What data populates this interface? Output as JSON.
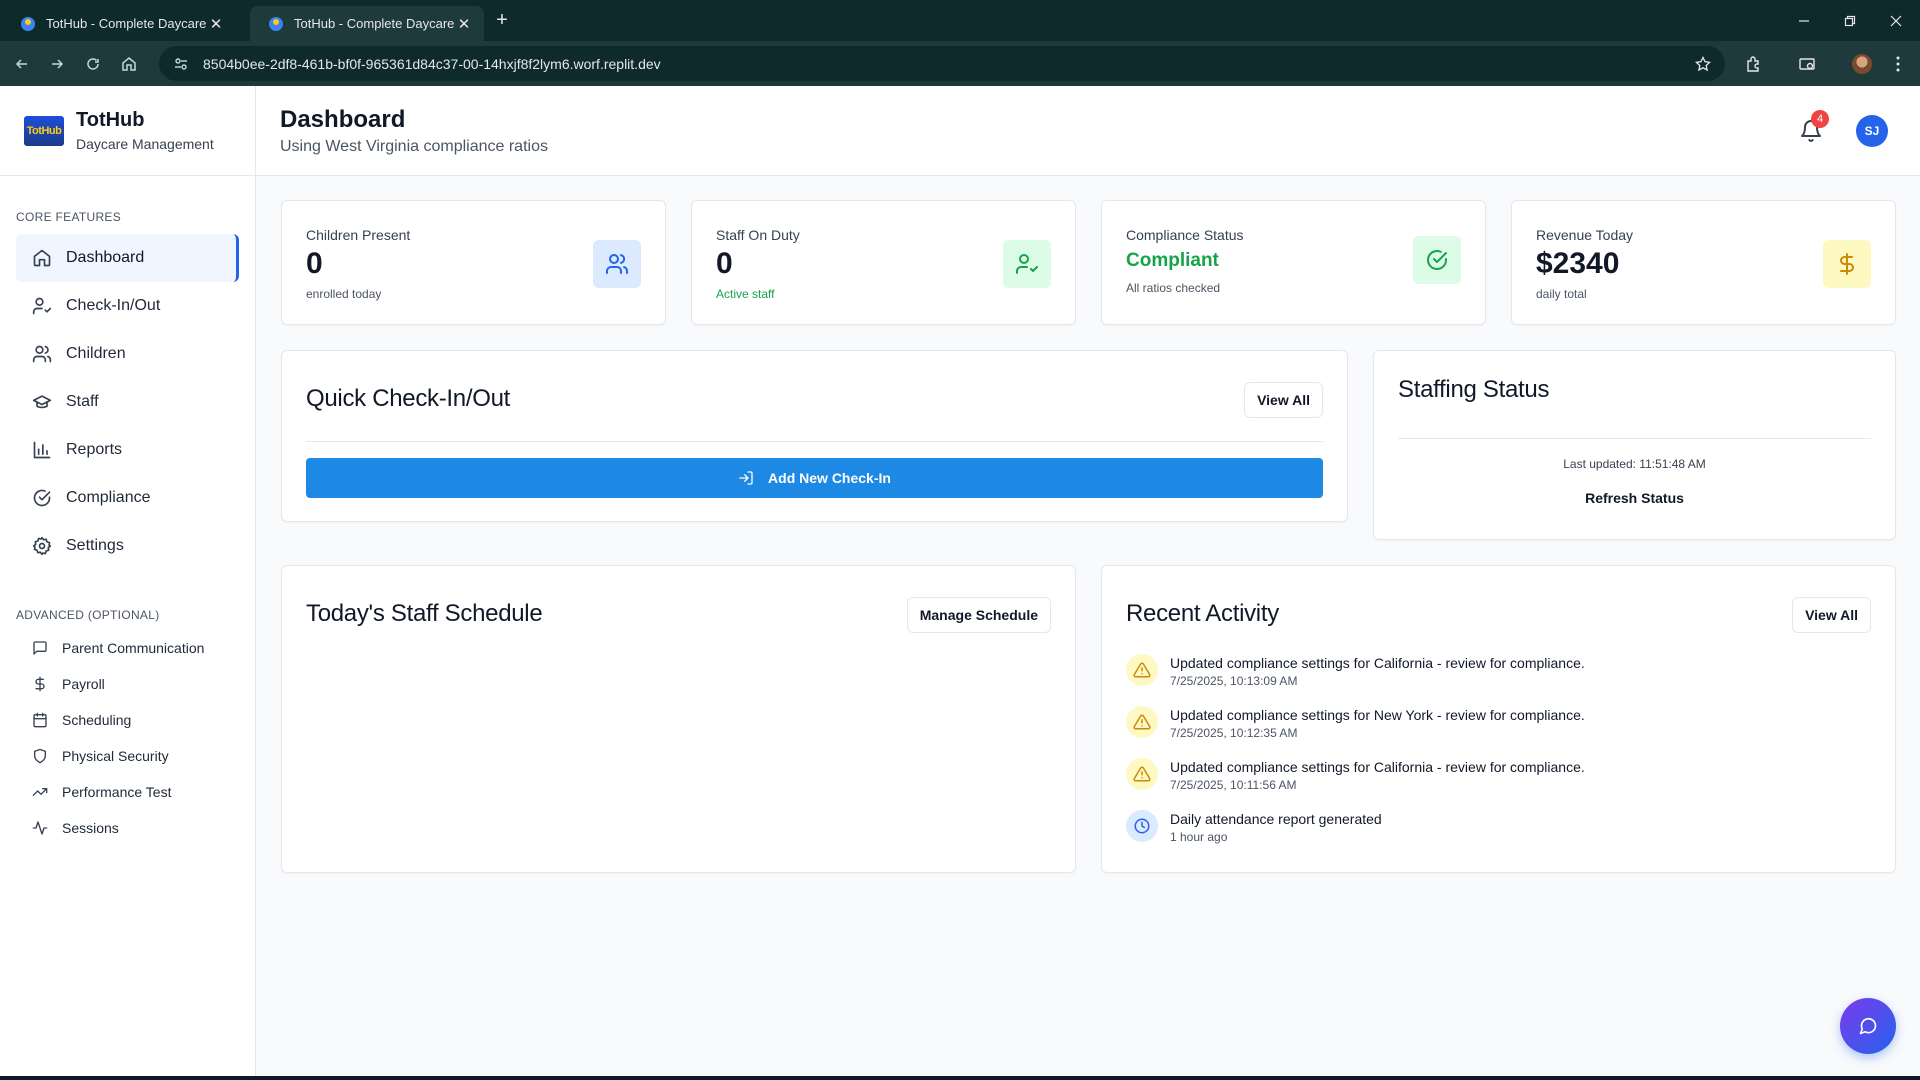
{
  "browser": {
    "tabs": [
      {
        "title": "TotHub - Complete Daycare Ma"
      },
      {
        "title": "TotHub - Complete Daycare Ma"
      }
    ],
    "url": "8504b0ee-2df8-461b-bf0f-965361d84c37-00-14hxjf8f2lym6.worf.replit.dev"
  },
  "sidebar": {
    "brand_logo_text": "TotHub",
    "brand_name": "TotHub",
    "brand_sub": "Daycare Management",
    "core_label": "CORE FEATURES",
    "core_items": [
      {
        "label": "Dashboard",
        "icon": "home-icon",
        "active": true
      },
      {
        "label": "Check-In/Out",
        "icon": "user-check-icon"
      },
      {
        "label": "Children",
        "icon": "users-icon"
      },
      {
        "label": "Staff",
        "icon": "graduation-cap-icon"
      },
      {
        "label": "Reports",
        "icon": "bar-chart-icon"
      },
      {
        "label": "Compliance",
        "icon": "check-circle-icon"
      },
      {
        "label": "Settings",
        "icon": "gear-icon"
      }
    ],
    "advanced_label": "ADVANCED (OPTIONAL)",
    "advanced_items": [
      {
        "label": "Parent Communication",
        "icon": "message-square-icon"
      },
      {
        "label": "Payroll",
        "icon": "dollar-icon"
      },
      {
        "label": "Scheduling",
        "icon": "calendar-icon"
      },
      {
        "label": "Physical Security",
        "icon": "shield-icon"
      },
      {
        "label": "Performance Test",
        "icon": "trending-up-icon"
      },
      {
        "label": "Sessions",
        "icon": "activity-icon"
      }
    ]
  },
  "header": {
    "title": "Dashboard",
    "subtitle": "Using West Virginia compliance ratios",
    "notification_count": "4",
    "user_initials": "SJ"
  },
  "stats": [
    {
      "label": "Children Present",
      "value": "0",
      "foot": "enrolled today",
      "icon": "users-icon",
      "icon_bg": "#dbeafe",
      "icon_color": "#2563eb"
    },
    {
      "label": "Staff On Duty",
      "value": "0",
      "foot": "Active staff",
      "icon": "user-check-icon",
      "icon_bg": "#dcfce7",
      "icon_color": "#16a34a"
    },
    {
      "label": "Compliance Status",
      "value": "Compliant",
      "foot": "All ratios checked",
      "icon": "check-circle-icon",
      "icon_bg": "#dcfce7",
      "icon_color": "#16a34a"
    },
    {
      "label": "Revenue Today",
      "value": "$2340",
      "foot": "daily total",
      "icon": "dollar-icon",
      "icon_bg": "#fef9c3",
      "icon_color": "#ca8a04"
    }
  ],
  "quick_checkin": {
    "title": "Quick Check-In/Out",
    "view_all": "View All",
    "add_button": "Add New Check-In"
  },
  "staffing": {
    "title": "Staffing Status",
    "last_updated": "Last updated: 11:51:48 AM",
    "refresh": "Refresh Status"
  },
  "schedule": {
    "title": "Today's Staff Schedule",
    "manage": "Manage Schedule"
  },
  "activity": {
    "title": "Recent Activity",
    "view_all": "View All",
    "items": [
      {
        "text": "Updated compliance settings for California - review for compliance.",
        "time": "7/25/2025, 10:13:09 AM",
        "icon": "alert-triangle-icon"
      },
      {
        "text": "Updated compliance settings for New York - review for compliance.",
        "time": "7/25/2025, 10:12:35 AM",
        "icon": "alert-triangle-icon"
      },
      {
        "text": "Updated compliance settings for California - review for compliance.",
        "time": "7/25/2025, 10:11:56 AM",
        "icon": "alert-triangle-icon"
      },
      {
        "text": "Daily attendance report generated",
        "time": "1 hour ago",
        "icon": "clock-icon"
      }
    ]
  },
  "colors": {
    "primary": "#1e88e5",
    "accent": "#2563eb",
    "success": "#16a34a",
    "warning": "#ca8a04",
    "badge": "#ef4444"
  }
}
